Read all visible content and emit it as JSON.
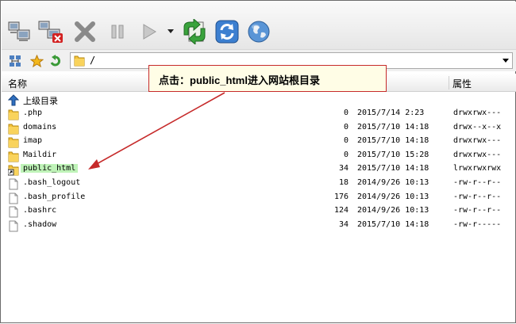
{
  "address": {
    "path": "/"
  },
  "columns": {
    "name": "名称",
    "attributes": "属性"
  },
  "callout": {
    "text": "点击：public_html进入网站根目录"
  },
  "up_row": {
    "label": "上级目录"
  },
  "files": [
    {
      "name": ".php",
      "size": "0",
      "date": "2015/7/14 2:23",
      "perm": "drwxrwx---",
      "type": "folder"
    },
    {
      "name": "domains",
      "size": "0",
      "date": "2015/7/10 14:18",
      "perm": "drwx--x--x",
      "type": "folder"
    },
    {
      "name": "imap",
      "size": "0",
      "date": "2015/7/10 14:18",
      "perm": "drwxrwx---",
      "type": "folder"
    },
    {
      "name": "Maildir",
      "size": "0",
      "date": "2015/7/10 15:28",
      "perm": "drwxrwx---",
      "type": "folder"
    },
    {
      "name": "public_html",
      "size": "34",
      "date": "2015/7/10 14:18",
      "perm": "lrwxrwxrwx",
      "type": "link",
      "selected": true
    },
    {
      "name": ".bash_logout",
      "size": "18",
      "date": "2014/9/26 10:13",
      "perm": "-rw-r--r--",
      "type": "file"
    },
    {
      "name": ".bash_profile",
      "size": "176",
      "date": "2014/9/26 10:13",
      "perm": "-rw-r--r--",
      "type": "file"
    },
    {
      "name": ".bashrc",
      "size": "124",
      "date": "2014/9/26 10:13",
      "perm": "-rw-r--r--",
      "type": "file"
    },
    {
      "name": ".shadow",
      "size": "34",
      "date": "2015/7/10 14:18",
      "perm": "-rw-r-----",
      "type": "file"
    }
  ],
  "icons": {
    "toolbar": [
      "connect-icon",
      "disconnect-icon",
      "delete-icon",
      "pause-icon",
      "play-icon",
      "dropdown-arrow-icon",
      "transfer-icon",
      "refresh-icon",
      "globe-icon"
    ],
    "address_bar": [
      "sitemanager-icon",
      "favorite-star-icon",
      "parent-folder-icon",
      "folder-icon"
    ]
  },
  "colors": {
    "callout_border": "#c62a2a",
    "callout_bg": "#fffde6",
    "selection": "#bff3b8",
    "arrow": "#c62a2a"
  }
}
